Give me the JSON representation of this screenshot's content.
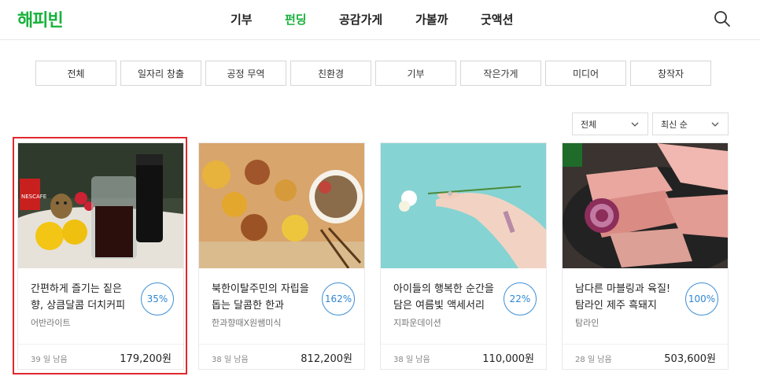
{
  "logo": "해피빈",
  "nav": [
    "기부",
    "펀딩",
    "공감가게",
    "가볼까",
    "굿액션"
  ],
  "nav_active": "펀딩",
  "categories": [
    "전체",
    "일자리 창출",
    "공정 무역",
    "친환경",
    "기부",
    "작은가게",
    "미디어",
    "창작자"
  ],
  "filters": {
    "category": "전체",
    "sort": "최신 순"
  },
  "cards": [
    {
      "title": "간편하게 즐기는 짙은 향, 상큼달콤 더치커피",
      "maker": "어반라이트",
      "percent": "35%",
      "days_left": "39 일 남음",
      "amount": "179,200원"
    },
    {
      "title": "북한이탈주민의 자립을 돕는 달콤한 한과",
      "maker": "한과향때X원쌤미식",
      "percent": "162%",
      "days_left": "38 일 남음",
      "amount": "812,200원"
    },
    {
      "title": "아이들의 행복한 순간을 담은 여름빛 액세서리",
      "maker": "지파운데이션",
      "percent": "22%",
      "days_left": "38 일 남음",
      "amount": "110,000원"
    },
    {
      "title": "남다른 마블링과 육질! 탐라인 제주 흑돼지",
      "maker": "탐라인",
      "percent": "100%",
      "days_left": "28 일 남음",
      "amount": "503,600원"
    }
  ],
  "colors": {
    "brand": "#18b13c",
    "percent": "#2f86d1",
    "highlight": "#e0282e"
  },
  "icons": {
    "search": "search-icon",
    "dropdown": "chevron-down-icon"
  }
}
